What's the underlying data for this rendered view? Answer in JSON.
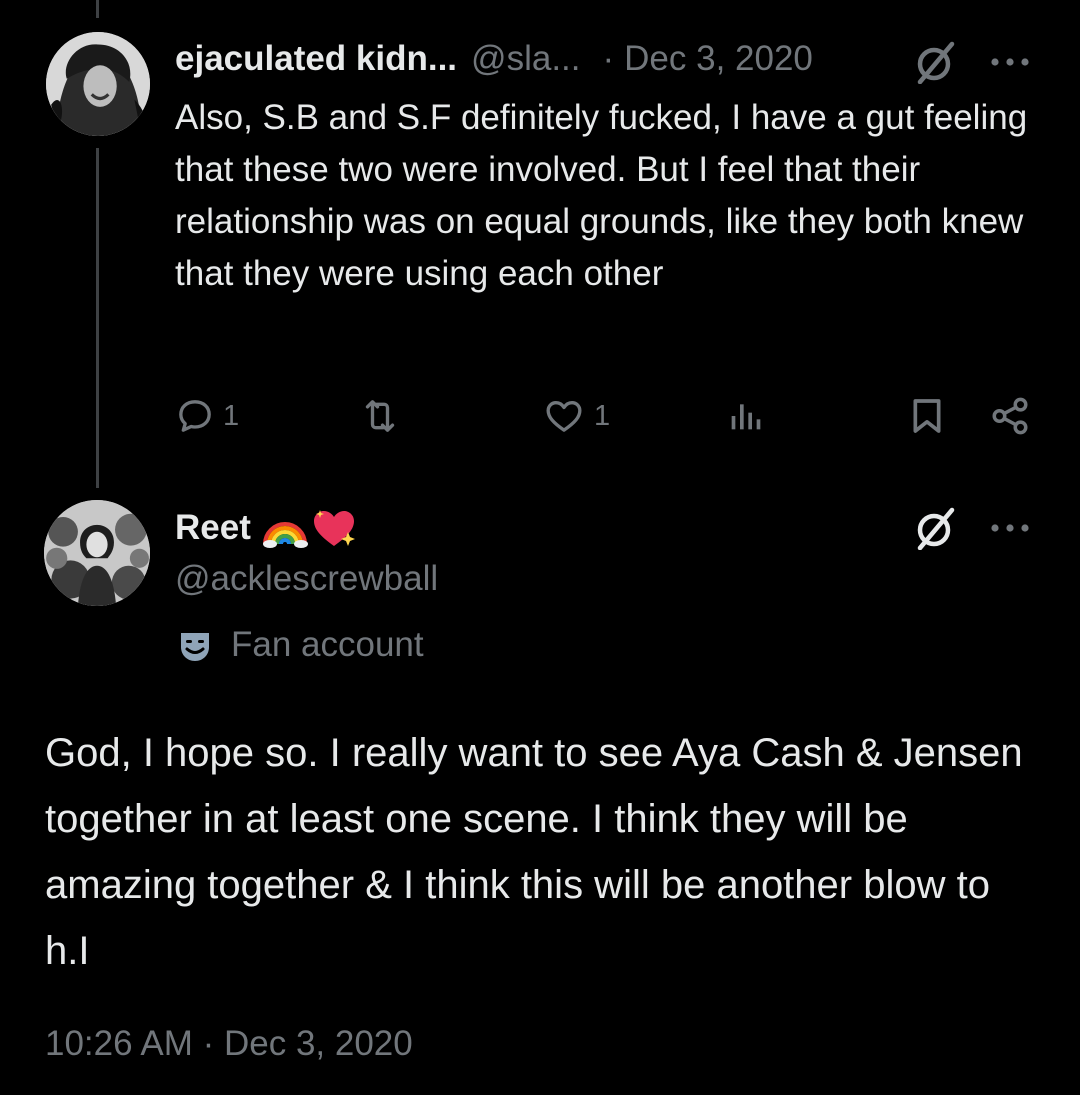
{
  "reply_tweet": {
    "display_name": "ejaculated kidn...",
    "handle": "@sla...",
    "separator": "·",
    "date": "Dec 3, 2020",
    "text": "Also, S.B and S.F definitely fucked, I have a gut feeling that these two were involved. But I feel that their relationship was on equal grounds, like they both knew that they were using each other",
    "actions": {
      "reply_count": "1",
      "retweet_count": "",
      "like_count": "1",
      "views_count": ""
    }
  },
  "main_tweet": {
    "display_name": "Reet",
    "name_emojis": [
      "rainbow-icon",
      "sparkling-heart-icon"
    ],
    "handle": "@acklescrewball",
    "label": "Fan account",
    "text": "God, I hope so. I really want to see Aya Cash & Jensen together in at least one scene. I think they will be amazing together & I think this will be another blow to h.I",
    "timestamp": "10:26 AM · Dec 3, 2020"
  },
  "colors": {
    "background": "#000000",
    "primary_text": "#e7e9ea",
    "secondary_text": "#71767b",
    "thread_line": "#3e4144"
  }
}
